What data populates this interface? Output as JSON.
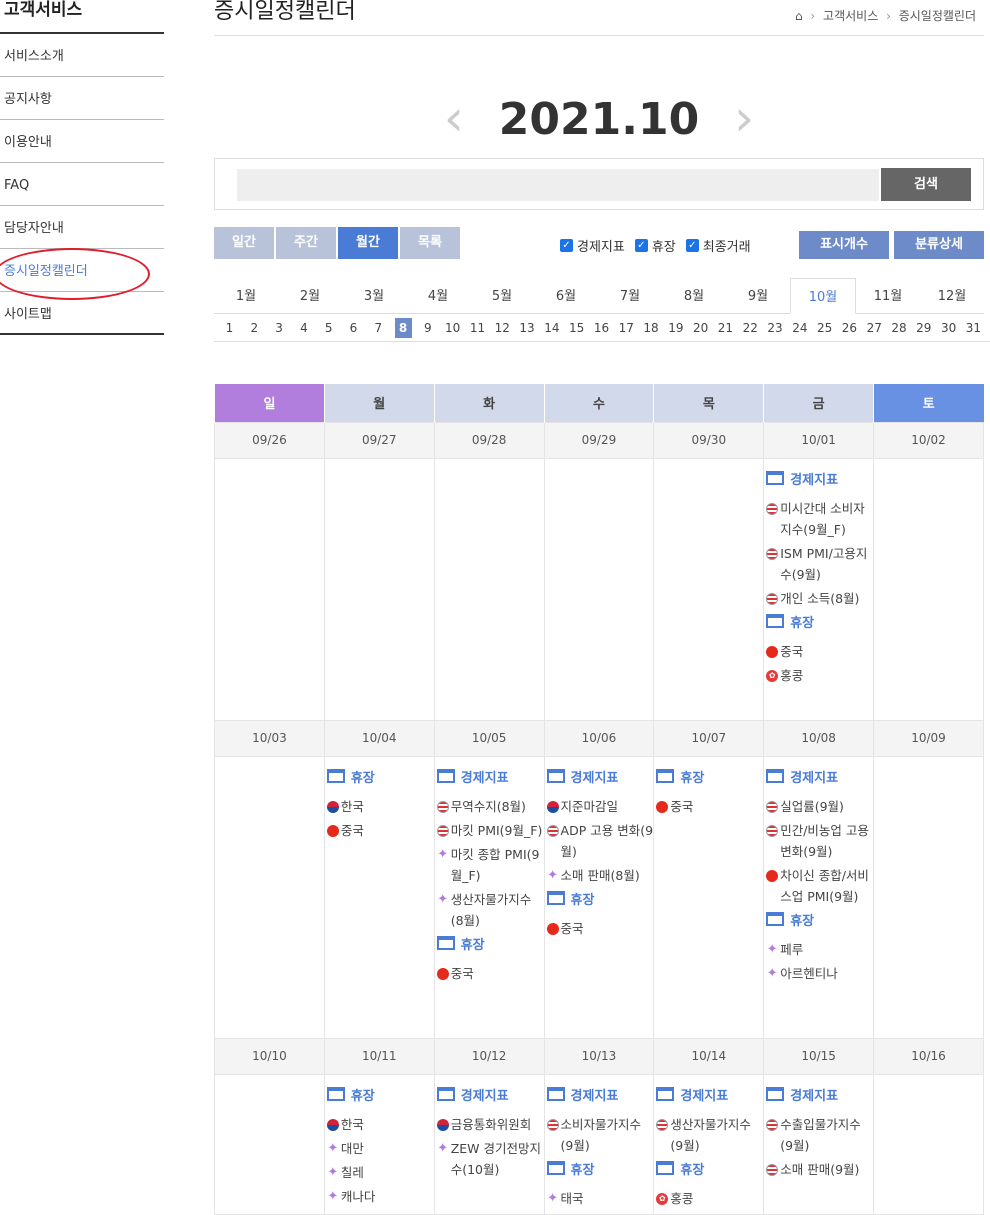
{
  "sidebar": {
    "title": "고객서비스",
    "items": [
      {
        "label": "서비스소개"
      },
      {
        "label": "공지사항"
      },
      {
        "label": "이용안내"
      },
      {
        "label": "FAQ"
      },
      {
        "label": "담당자안내"
      },
      {
        "label": "증시일정캘린더"
      },
      {
        "label": "사이트맵"
      }
    ],
    "active_item": "증시일정캘린더"
  },
  "header": {
    "title": "증시일정캘린더",
    "breadcrumb": [
      "고객서비스",
      "증시일정캘린더"
    ],
    "separator": "›"
  },
  "month_nav": {
    "label": "2021.10",
    "prev": "‹",
    "next": "›"
  },
  "search": {
    "value": "",
    "placeholder": "",
    "button_label": "검색"
  },
  "view_tabs": [
    {
      "label": "일간"
    },
    {
      "label": "주간"
    },
    {
      "label": "월간",
      "active": true
    },
    {
      "label": "목록"
    }
  ],
  "filters": [
    {
      "label": "경제지표",
      "checked": true
    },
    {
      "label": "휴장",
      "checked": true
    },
    {
      "label": "최종거래",
      "checked": true
    }
  ],
  "buttons": {
    "display_count": "표시개수",
    "category_detail": "분류상세"
  },
  "months": [
    "1월",
    "2월",
    "3월",
    "4월",
    "5월",
    "6월",
    "7월",
    "8월",
    "9월",
    "10월",
    "11월",
    "12월"
  ],
  "active_month": "10월",
  "days": [
    "1",
    "2",
    "3",
    "4",
    "5",
    "6",
    "7",
    "8",
    "9",
    "10",
    "11",
    "12",
    "13",
    "14",
    "15",
    "16",
    "17",
    "18",
    "19",
    "20",
    "21",
    "22",
    "23",
    "24",
    "25",
    "26",
    "27",
    "28",
    "29",
    "30",
    "31"
  ],
  "active_day": "8",
  "weekdays": [
    "일",
    "월",
    "화",
    "수",
    "목",
    "금",
    "토"
  ],
  "weeks": [
    {
      "dates": [
        "09/26",
        "09/27",
        "09/28",
        "09/29",
        "09/30",
        "10/01",
        "10/02"
      ],
      "height": 262,
      "cells": [
        [],
        [],
        [],
        [],
        [],
        [
          {
            "title": "경제지표",
            "events": [
              {
                "flag": "us",
                "text": "미시간대 소비자지수(9월_F)"
              },
              {
                "flag": "us",
                "text": "ISM PMI/고용지수(9월)"
              },
              {
                "flag": "us",
                "text": "개인 소득(8월)"
              }
            ]
          },
          {
            "title": "휴장",
            "events": [
              {
                "flag": "cn",
                "text": "중국"
              },
              {
                "flag": "hk",
                "text": "홍콩"
              }
            ]
          }
        ],
        []
      ]
    },
    {
      "dates": [
        "10/03",
        "10/04",
        "10/05",
        "10/06",
        "10/07",
        "10/08",
        "10/09"
      ],
      "height": 282,
      "cells": [
        [],
        [
          {
            "title": "휴장",
            "events": [
              {
                "flag": "kr",
                "text": "한국"
              },
              {
                "flag": "cn",
                "text": "중국"
              }
            ]
          }
        ],
        [
          {
            "title": "경제지표",
            "events": [
              {
                "flag": "us",
                "text": "무역수지(8월)"
              },
              {
                "flag": "us",
                "text": "마킷 PMI(9월_F)"
              },
              {
                "flag": "star",
                "text": "마킷 종합 PMI(9월_F)"
              },
              {
                "flag": "star",
                "text": "생산자물가지수(8월)"
              }
            ]
          },
          {
            "title": "휴장",
            "events": [
              {
                "flag": "cn",
                "text": "중국"
              }
            ]
          }
        ],
        [
          {
            "title": "경제지표",
            "events": [
              {
                "flag": "kr",
                "text": "지준마감일"
              },
              {
                "flag": "us",
                "text": "ADP 고용 변화(9월)"
              },
              {
                "flag": "star",
                "text": "소매 판매(8월)"
              }
            ]
          },
          {
            "title": "휴장",
            "events": [
              {
                "flag": "cn",
                "text": "중국"
              }
            ]
          }
        ],
        [
          {
            "title": "휴장",
            "events": [
              {
                "flag": "cn",
                "text": "중국"
              }
            ]
          }
        ],
        [
          {
            "title": "경제지표",
            "events": [
              {
                "flag": "us",
                "text": "실업률(9월)"
              },
              {
                "flag": "us",
                "text": "민간/비농업 고용 변화(9월)"
              },
              {
                "flag": "cn",
                "text": "차이신 종합/서비스업 PMI(9월)"
              }
            ]
          },
          {
            "title": "휴장",
            "events": [
              {
                "flag": "star",
                "text": "페루"
              },
              {
                "flag": "star",
                "text": "아르헨티나"
              }
            ]
          }
        ],
        []
      ]
    },
    {
      "dates": [
        "10/10",
        "10/11",
        "10/12",
        "10/13",
        "10/14",
        "10/15",
        "10/16"
      ],
      "height": 140,
      "cells": [
        [],
        [
          {
            "title": "휴장",
            "events": [
              {
                "flag": "kr",
                "text": "한국"
              },
              {
                "flag": "star",
                "text": "대만"
              },
              {
                "flag": "star",
                "text": "칠레"
              },
              {
                "flag": "star",
                "text": "캐나다"
              }
            ]
          }
        ],
        [
          {
            "title": "경제지표",
            "events": [
              {
                "flag": "kr",
                "text": "금융통화위원회"
              },
              {
                "flag": "star",
                "text": "ZEW 경기전망지수(10월)"
              }
            ]
          }
        ],
        [
          {
            "title": "경제지표",
            "events": [
              {
                "flag": "us",
                "text": "소비자물가지수(9월)"
              }
            ]
          },
          {
            "title": "휴장",
            "events": [
              {
                "flag": "star",
                "text": "태국"
              }
            ]
          }
        ],
        [
          {
            "title": "경제지표",
            "events": [
              {
                "flag": "us",
                "text": "생산자물가지수(9월)"
              }
            ]
          },
          {
            "title": "휴장",
            "events": [
              {
                "flag": "hk",
                "text": "홍콩"
              }
            ]
          }
        ],
        [
          {
            "title": "경제지표",
            "events": [
              {
                "flag": "us",
                "text": "수출입물가지수(9월)"
              },
              {
                "flag": "us",
                "text": "소매 판매(9월)"
              }
            ]
          }
        ],
        []
      ]
    }
  ]
}
